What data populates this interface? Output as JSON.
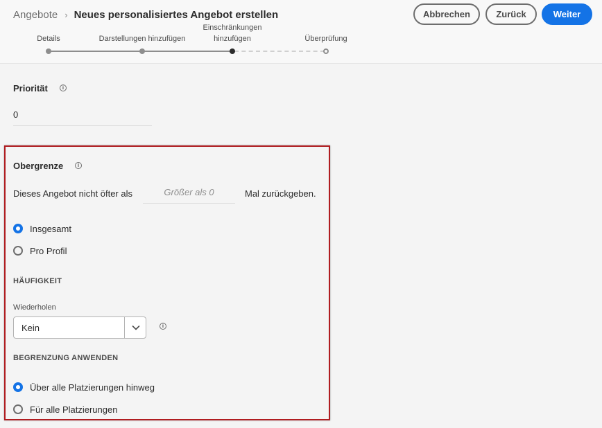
{
  "header": {
    "breadcrumb_parent": "Angebote",
    "breadcrumb_separator": "›",
    "title": "Neues personalisiertes Angebot erstellen",
    "buttons": {
      "cancel": "Abbrechen",
      "back": "Zurück",
      "next": "Weiter"
    }
  },
  "stepper": {
    "steps": [
      {
        "label": "Details",
        "state": "done"
      },
      {
        "label": "Darstellungen hinzufügen",
        "state": "done"
      },
      {
        "label_line1": "Einschränkungen",
        "label_line2": "hinzufügen",
        "state": "current"
      },
      {
        "label": "Überprüfung",
        "state": "upcoming"
      }
    ]
  },
  "priority": {
    "title": "Priorität",
    "info_icon": "info-icon",
    "value": "0"
  },
  "cap": {
    "title": "Obergrenze",
    "info_icon": "info-icon",
    "sentence_before": "Dieses Angebot nicht öfter als",
    "input_placeholder": "Größer als 0",
    "sentence_after": "Mal zurückgeben.",
    "scope_options": [
      {
        "label": "Insgesamt",
        "checked": true
      },
      {
        "label": "Pro Profil",
        "checked": false
      }
    ],
    "frequency_heading": "HÄUFIGKEIT",
    "repeat_label": "Wiederholen",
    "repeat_value": "Kein",
    "apply_heading": "BEGRENZUNG ANWENDEN",
    "apply_options": [
      {
        "label": "Über alle Platzierungen hinweg",
        "checked": true
      },
      {
        "label": "Für alle Platzierungen",
        "checked": false
      }
    ]
  },
  "colors": {
    "accent": "#1473e6",
    "highlight_border": "#b01c20",
    "background": "#f4f4f4"
  }
}
